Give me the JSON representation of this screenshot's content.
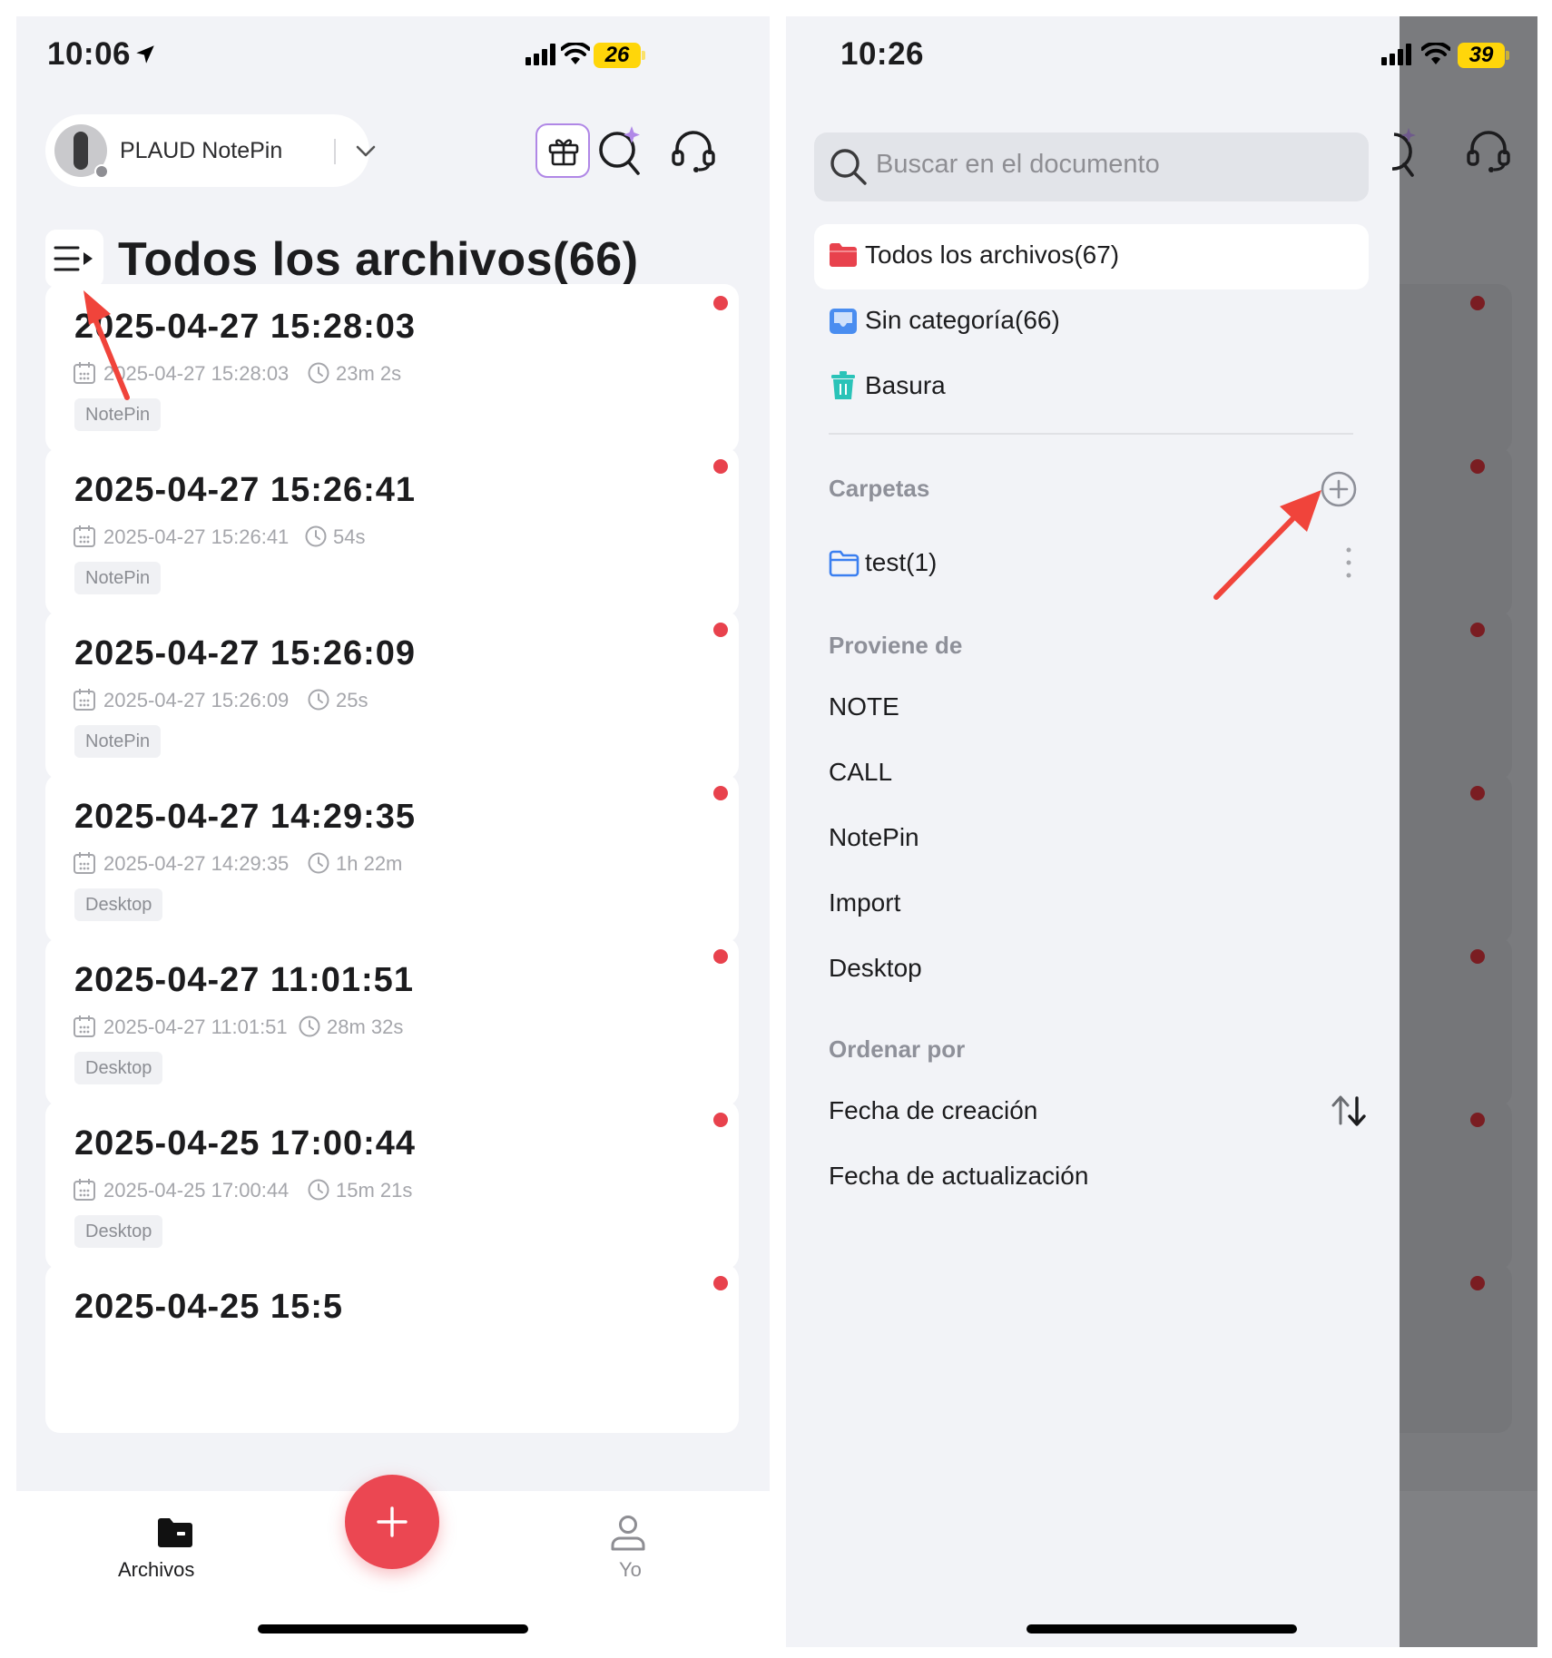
{
  "left": {
    "status": {
      "time": "10:06",
      "battery": "26"
    },
    "device": {
      "name": "PLAUD NotePin"
    },
    "title": "Todos los archivos(66)",
    "files": [
      {
        "title": "2025-04-27 15:28:03",
        "date": "2025-04-27 15:28:03",
        "duration": "23m 2s",
        "tag": "NotePin",
        "unread": true
      },
      {
        "title": "2025-04-27 15:26:41",
        "date": "2025-04-27 15:26:41",
        "duration": "54s",
        "tag": "NotePin",
        "unread": true
      },
      {
        "title": "2025-04-27 15:26:09",
        "date": "2025-04-27 15:26:09",
        "duration": "25s",
        "tag": "NotePin",
        "unread": true
      },
      {
        "title": "2025-04-27 14:29:35",
        "date": "2025-04-27 14:29:35",
        "duration": "1h 22m",
        "tag": "Desktop",
        "unread": true
      },
      {
        "title": "2025-04-27 11:01:51",
        "date": "2025-04-27 11:01:51",
        "duration": "28m 32s",
        "tag": "Desktop",
        "unread": true
      },
      {
        "title": "2025-04-25 17:00:44",
        "date": "2025-04-25 17:00:44",
        "duration": "15m 21s",
        "tag": "Desktop",
        "unread": true
      },
      {
        "title": "2025-04-25 15:5",
        "unread": true
      }
    ],
    "tabbar": {
      "files": "Archivos",
      "me": "Yo"
    }
  },
  "right": {
    "status": {
      "time": "10:26",
      "battery": "39"
    },
    "search": {
      "placeholder": "Buscar en el documento"
    },
    "nav": {
      "all_files": "Todos los archivos(67)",
      "uncategorized": "Sin categoría(66)",
      "trash": "Basura"
    },
    "folders": {
      "heading": "Carpetas",
      "items": [
        {
          "name": "test(1)"
        }
      ]
    },
    "source": {
      "heading": "Proviene de",
      "items": [
        "NOTE",
        "CALL",
        "NotePin",
        "Import",
        "Desktop"
      ]
    },
    "sort": {
      "heading": "Ordenar por",
      "items": [
        "Fecha de creación",
        "Fecha de actualización"
      ]
    }
  },
  "colors": {
    "accent_red": "#eb4752",
    "unread_dot": "#e8424d",
    "gift_border": "#b087e6",
    "annotation_arrow": "#f0443b",
    "battery": "#ffd60a"
  }
}
